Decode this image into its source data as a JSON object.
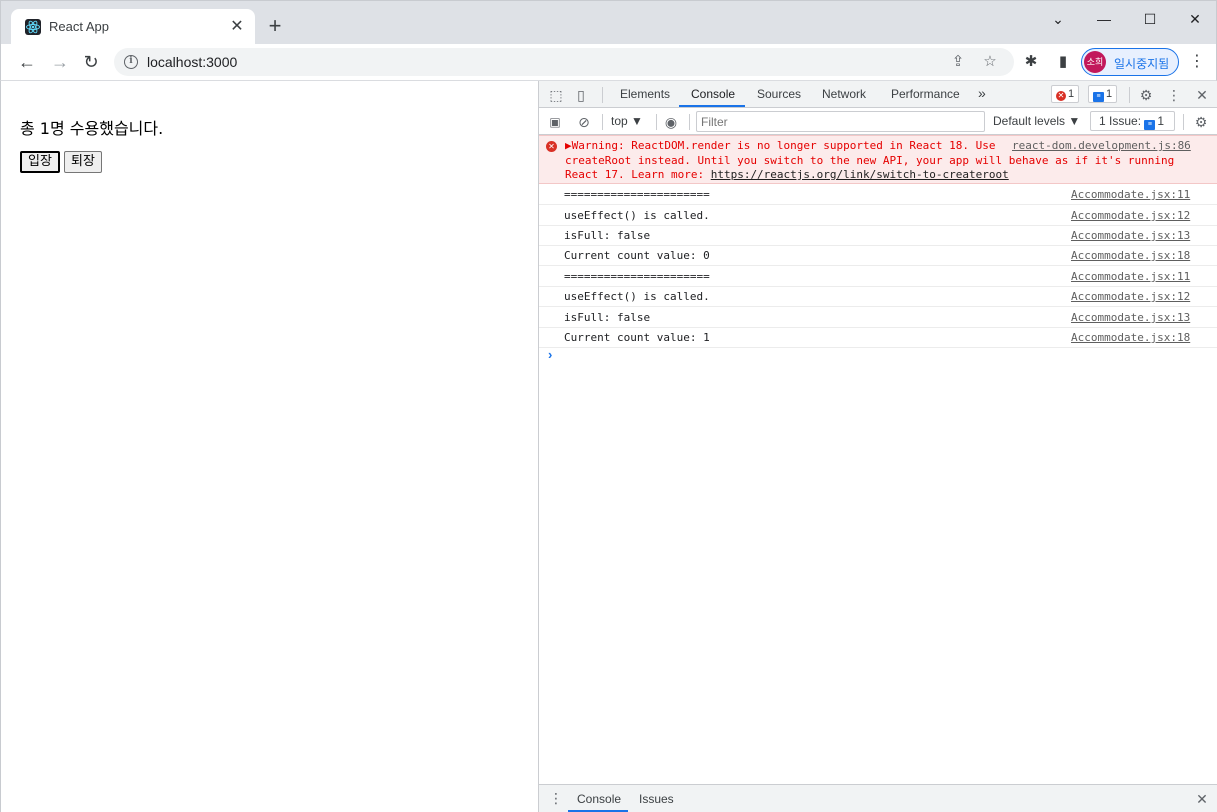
{
  "browser": {
    "tab_title": "React App",
    "tab_close": "✕",
    "new_tab": "+",
    "window_controls": {
      "chevron": "⌄",
      "minimize": "—",
      "maximize": "☐",
      "close": "✕"
    },
    "url": "localhost:3000",
    "profile_avatar": "소희",
    "profile_status": "일시중지됨",
    "icons": {
      "back": "←",
      "forward": "→",
      "reload": "↻",
      "share": "⇪",
      "bookmark": "☆",
      "extensions": "✱",
      "side_panel": "▮",
      "menu": "⋮"
    }
  },
  "page": {
    "message": "총 1명 수용했습니다.",
    "enter_button": "입장",
    "exit_button": "퇴장"
  },
  "devtools": {
    "tabs": [
      "Elements",
      "Console",
      "Sources",
      "Network",
      "Performance"
    ],
    "active_tab": "Console",
    "more_tabs": "»",
    "error_count": "1",
    "message_count": "1",
    "context": "top ▼",
    "filter_placeholder": "Filter",
    "default_levels": "Default levels ▼",
    "issues_label": "1 Issue:",
    "issues_count": "1",
    "warning": {
      "line1": "▶Warning: ReactDOM.render is no longer supported in React 18. Use",
      "line2": "createRoot instead. Until you switch to the new API, your app will behave as if it's running",
      "line3_prefix": "React 17. Learn more: ",
      "link": "https://reactjs.org/link/switch-to-createroot",
      "source": "react-dom.development.js:86"
    },
    "logs": [
      {
        "text": "======================",
        "source": "Accommodate.jsx:11"
      },
      {
        "text": "useEffect() is called.",
        "source": "Accommodate.jsx:12"
      },
      {
        "text": "isFull: false",
        "source": "Accommodate.jsx:13"
      },
      {
        "text": "Current count value: 0",
        "source": "Accommodate.jsx:18"
      },
      {
        "text": "======================",
        "source": "Accommodate.jsx:11"
      },
      {
        "text": "useEffect() is called.",
        "source": "Accommodate.jsx:12"
      },
      {
        "text": "isFull: false",
        "source": "Accommodate.jsx:13"
      },
      {
        "text": "Current count value: 1",
        "source": "Accommodate.jsx:18"
      }
    ],
    "prompt": "›",
    "drawer_tabs": [
      "Console",
      "Issues"
    ]
  }
}
